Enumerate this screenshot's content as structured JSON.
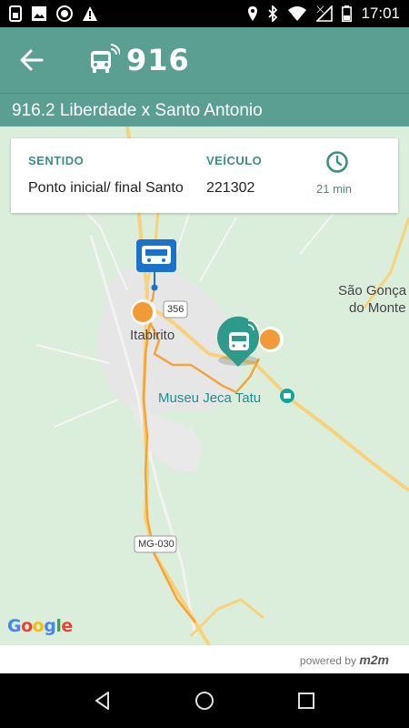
{
  "status_bar": {
    "time": "17:01",
    "icons_left": [
      "sim-icon",
      "image-icon",
      "media-icon",
      "warning-icon"
    ],
    "icons_right": [
      "location-icon",
      "bluetooth-icon",
      "wifi-icon",
      "signal-icon",
      "battery-icon"
    ]
  },
  "header": {
    "title": "916",
    "back_icon": "arrow-left-icon",
    "bus_icon": "bus-realtime-icon"
  },
  "route": {
    "name": "916.2 Liberdade x Santo Antonio"
  },
  "info_card": {
    "sentido_label": "SENTIDO",
    "veiculo_label": "VEÍCULO",
    "sentido_value": "Ponto inicial/ final Santo",
    "veiculo_value": "221302",
    "eta": "21 min",
    "clock_icon": "clock-icon"
  },
  "map": {
    "labels": {
      "city": "Itabirito",
      "museum": "Museu Jeca Tatu",
      "town_line1": "São Gonça",
      "town_line2": "do Monte",
      "road_356": "356",
      "road_mg030": "MG-030"
    },
    "google": [
      "G",
      "o",
      "o",
      "g",
      "l",
      "e"
    ],
    "colors": {
      "route": "#f5a33a",
      "stop": "#f29a38",
      "vehicle": "#2e9a8c",
      "bus_stop": "#1a73c9"
    }
  },
  "footer": {
    "powered_by": "powered by",
    "brand": "m2m"
  },
  "nav": {
    "back": "back-triangle-icon",
    "home": "home-circle-icon",
    "recents": "recents-square-icon"
  },
  "theme": {
    "primary": "#5a9f92",
    "accent": "#3f8f80"
  }
}
